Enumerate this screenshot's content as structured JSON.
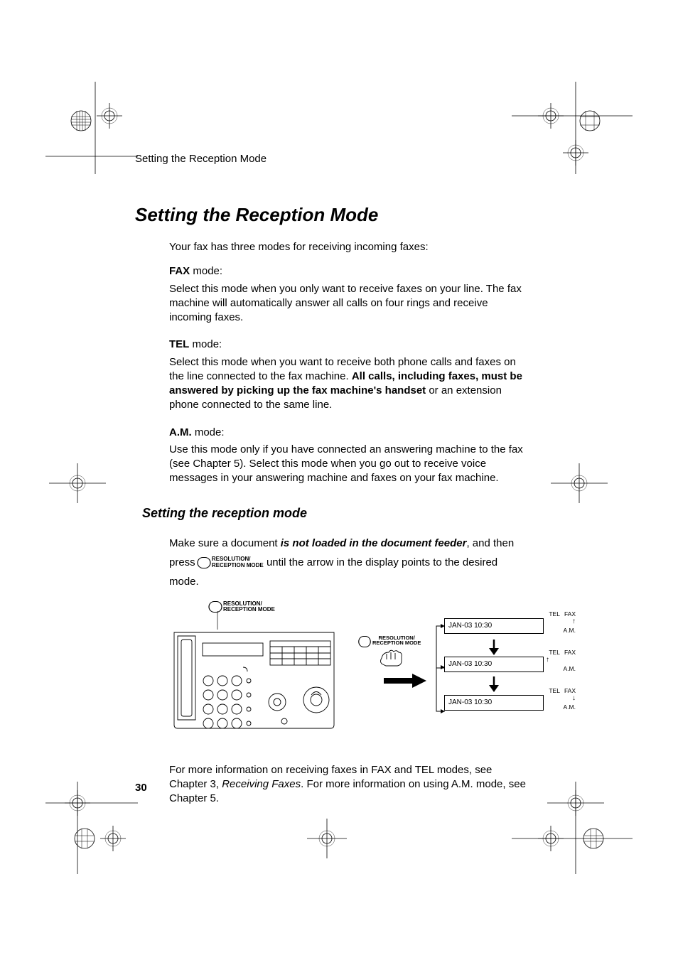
{
  "header": {
    "running_head": "Setting the Reception Mode"
  },
  "title": "Setting the Reception Mode",
  "intro": "Your fax has three modes for receiving incoming faxes:",
  "modes": {
    "fax": {
      "label": "FAX",
      "suffix": " mode:",
      "body": "Select this mode when you only want to receive faxes on your line. The fax machine will automatically answer all calls on four rings and receive incoming faxes."
    },
    "tel": {
      "label": "TEL",
      "suffix": " mode:",
      "body_pre": "Select this mode when you want to receive both phone calls and faxes on the line connected to the fax machine. ",
      "body_bold": "All calls, including faxes, must be answered by picking up the fax machine's handset",
      "body_post": " or an extension phone connected to the same line."
    },
    "am": {
      "label": "A.M.",
      "suffix": " mode:",
      "body": "Use this mode only if you have connected an answering machine to the fax (see Chapter 5). Select this mode when you go out to receive voice messages in your answering machine and faxes on your fax machine."
    }
  },
  "subsection_title": "Setting the reception mode",
  "instruction": {
    "pre": "Make sure a document ",
    "bold_it": "is not loaded in the document feeder",
    "mid": ", and then press ",
    "post": " until the arrow in the display points to the desired mode."
  },
  "button": {
    "l1": "RESOLUTION/",
    "l2": "RECEPTION MODE"
  },
  "lcd": {
    "text": "JAN-03 10:30",
    "tel": "TEL",
    "fax": "FAX",
    "am": "A.M.",
    "arrows": {
      "up": "↑",
      "down": "↓"
    }
  },
  "caption": {
    "pre": "For more information on receiving faxes in FAX and TEL modes, see Chapter 3, ",
    "it": "Receiving Faxes",
    "post": ". For more information on using A.M. mode, see Chapter 5."
  },
  "page_number": "30"
}
